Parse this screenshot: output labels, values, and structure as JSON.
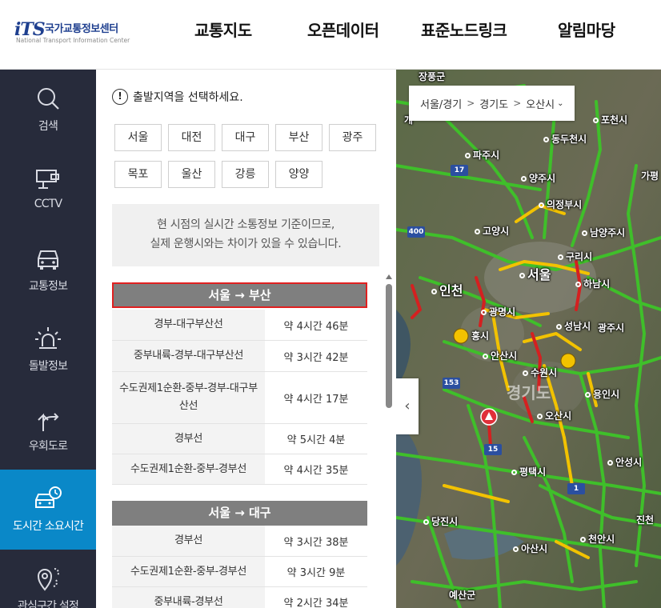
{
  "header": {
    "logo_mark": "iTS",
    "logo_kr": "국가교통정보센터",
    "logo_en": "National Transport Information Center",
    "nav": [
      "교통지도",
      "오픈데이터",
      "표준노드링크",
      "알림마당"
    ]
  },
  "sidebar": {
    "items": [
      {
        "label": "검색",
        "icon": "search-icon"
      },
      {
        "label": "CCTV",
        "icon": "cctv-icon"
      },
      {
        "label": "교통정보",
        "icon": "car-icon"
      },
      {
        "label": "돌발정보",
        "icon": "alert-light-icon"
      },
      {
        "label": "우회도로",
        "icon": "detour-arrow-icon"
      },
      {
        "label": "도시간 소요시간",
        "icon": "intercity-time-icon",
        "active": true
      },
      {
        "label": "관심구간 설정",
        "icon": "location-pin-icon"
      }
    ]
  },
  "panel": {
    "prompt": "출발지역을 선택하세요.",
    "cities": [
      "서울",
      "대전",
      "대구",
      "부산",
      "광주",
      "목포",
      "울산",
      "강릉",
      "양양"
    ],
    "notice_line1": "현 시점의 실시간 소통정보 기준이므로,",
    "notice_line2": "실제 운행시와는 차이가 있을 수 있습니다.",
    "groups": [
      {
        "title": "서울 → 부산",
        "selected": true,
        "routes": [
          {
            "name": "경부-대구부산선",
            "time": "약 4시간 46분"
          },
          {
            "name": "중부내륙-경부-대구부산선",
            "time": "약 3시간 42분"
          },
          {
            "name": "수도권제1순환-중부-경부-대구부산선",
            "time": "약 4시간 17분"
          },
          {
            "name": "경부선",
            "time": "약 5시간 4분"
          },
          {
            "name": "수도권제1순환-중부-경부선",
            "time": "약 4시간 35분"
          }
        ]
      },
      {
        "title": "서울 → 대구",
        "selected": false,
        "routes": [
          {
            "name": "경부선",
            "time": "약 3시간 38분"
          },
          {
            "name": "수도권제1순환-중부-경부선",
            "time": "약 3시간 9분"
          },
          {
            "name": "중부내륙-경부선",
            "time": "약 2시간 34분"
          }
        ]
      }
    ]
  },
  "map": {
    "breadcrumb": [
      "서울/경기",
      "경기도",
      "오산시"
    ],
    "breadcrumb_suffix": "⌄",
    "collapse_icon": "‹",
    "region_label": "경기도",
    "labels": {
      "jangpung": "장풍군",
      "dongducheon": "동두천시",
      "pocheon": "포천시",
      "paju": "파주시",
      "yangju": "양주시",
      "gapyeong": "가평",
      "uijeongbu": "의정부시",
      "goyang": "고양시",
      "namyangju": "남양주시",
      "guri": "구리시",
      "seoul": "서울",
      "incheon": "인천",
      "hanam": "하남시",
      "gwangmyeong": "광명시",
      "siheung": "흥시",
      "seongnam": "성남시",
      "gwangju": "광주시",
      "ansan": "안산시",
      "suwon": "수원시",
      "yongin": "용인시",
      "osan": "오산시",
      "pyeongtaek": "평택시",
      "anseong": "안성시",
      "dangjin": "당진시",
      "jincheon": "진천",
      "asan": "아산시",
      "cheonan": "천안시",
      "yesan": "예산군",
      "gae": "개"
    },
    "shields": [
      "17",
      "400",
      "153",
      "15",
      "1"
    ]
  },
  "colors": {
    "sidebar_bg": "#272b3b",
    "sidebar_active": "#0a88c8",
    "route_header": "#7f7f7f",
    "selected_border": "#e02020",
    "road_green": "#3fbf2a",
    "road_yellow": "#f2c200",
    "road_red": "#d42020"
  }
}
